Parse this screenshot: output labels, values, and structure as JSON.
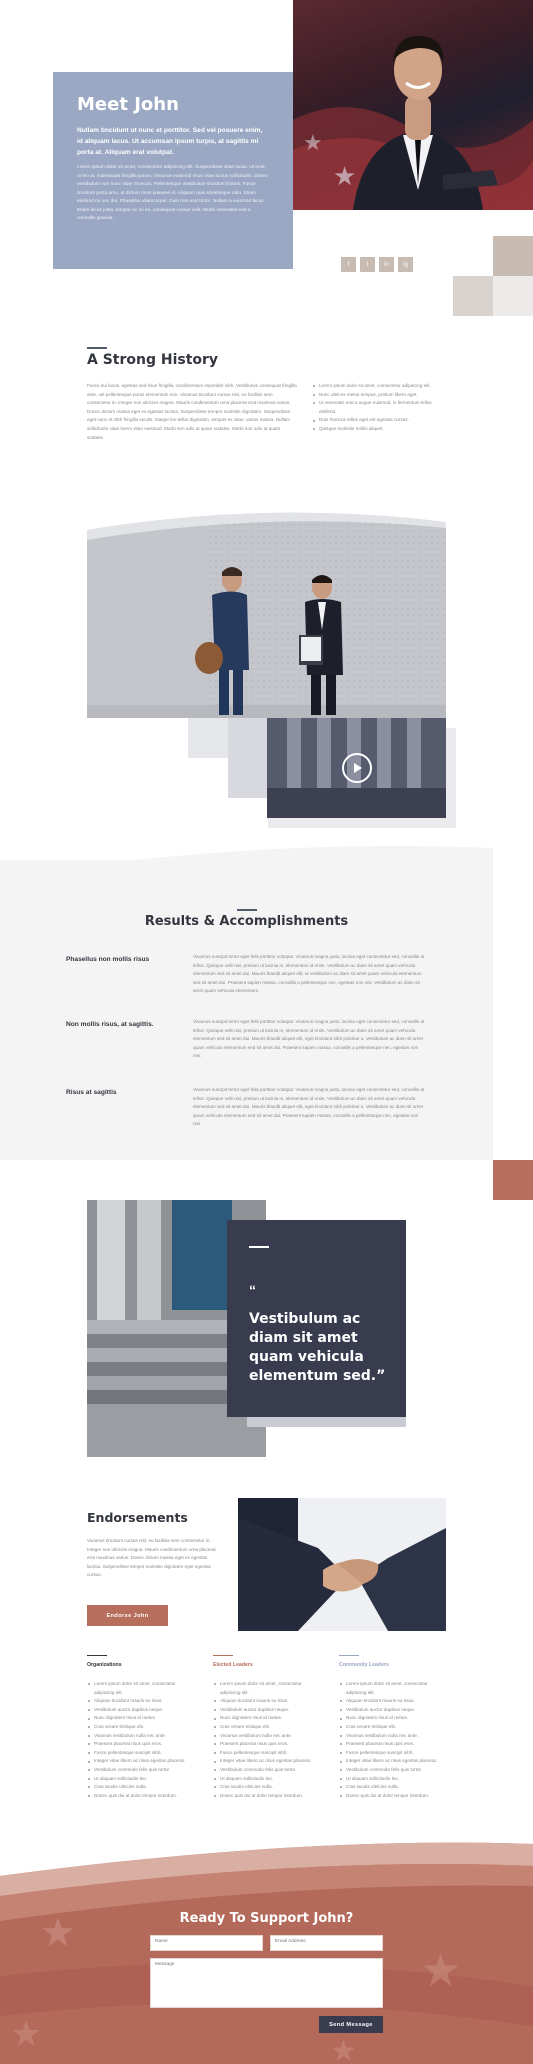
{
  "colors": {
    "accent_blue": "#9aa8c4",
    "navy": "#393b4f",
    "terracotta": "#b86e5c",
    "tan": "#c8bbb2",
    "light_gray": "#f4f4f5"
  },
  "hero": {
    "title": "Meet John",
    "lead": "Nullam tincidunt ut nunc et porttitor. Sed vel posuere enim, id aliquam lacus. Ut accumsan ipsum turpis, at sagittis mi porta at. Aliquam erat volutpat.",
    "body": "Lorem ipsum dolor sit amet, consectetur adipiscing elit. Suspendisse vitae lacus. Ut enim ut leo at, malesuada fringilla ipsum. Vivamus euismod risus vitae luctus sollicitudin. Donec vestibulum non nunc vitae rhoncus. Pellentesque vestibulum tincidunt finibus. Fusce tincidunt porta arcu, at dictum risus posuere id. Aliquam quis scelerisque odio. Etiam eleifend mi nec dui. Phasellus ullamcorper. Duis non erat tortor. Nullam a euismod lacus. Etiam lacus justo, tempor ac mi eu, consequat cursus velit. Morbi venenatis erat a convallis gravida.",
    "social": [
      "f",
      "t",
      "in",
      "ig"
    ],
    "social_icons": [
      "facebook-icon",
      "twitter-icon",
      "linkedin-icon",
      "instagram-icon"
    ]
  },
  "history": {
    "title": "A Strong History",
    "paragraph": "Fusce dui lacus, egestas sed risus fringilla, condimentum imperdiet nibh. Vestibulum consequat fringilla ante, vel pellentesque purus elementum non. Vivamus tincidunt cursus nisl, eu facilisis sem consectetur in. Integer non ultricies magna. Mauris condimentum urna placerat erat maximus varius. Donec dictum massa eget ex egestas lacinia. Suspendisse tempor molestie dignissim. Suspendisse eget nunc et nibh fringilla iaculis. Integer leo tellus dignissim, tempus ex vitae, varius massa. Nullam sollicitudin vitae lorem vitae euismod. Morbi non odio at quam sodales. Morbi non odio at quam sodales.",
    "bullets": [
      "Lorem ipsum dolor sit amet, consectetur adipiscing elit.",
      "Nunc ultrices metus tempus, pretium libero eget.",
      "Ut venenatis erat a augue euismod, in fermentum tellus eleifend.",
      "Duis rhoncus tellus eget est egestas cursus.",
      "Quisque molestie mollis aliquet."
    ]
  },
  "results": {
    "title": "Results & Accomplishments",
    "items": [
      {
        "heading": "Phasellus non mollis risus",
        "text": "Vivamus suscipit tortor eget felis porttitor volutpat. Vivamus magna justo, lacinia eget consectetur sed, convallis at tellus. Quisque velit nisi, pretium ut lacinia in, elementum id enim. Vestibulum ac diam sit amet quam vehicula elementum sed sit amet dui. Mauris blandit aliquet elit, ut vestibulum ac diam sit amet quam vehicula elementum sed sit amet dui. Praesent sapien massa, convallis a pellentesque nec, egestas non nisi. Vestibulum ac diam sit amet quam vehicula elementum."
      },
      {
        "heading": "Non mollis risus, at sagittis.",
        "text": "Vivamus suscipit tortor eget felis porttitor volutpat. Vivamus magna justo, lacinia eget consectetur sed, convallis at tellus. Quisque velit nisi, pretium ut lacinia in, elementum id enim. Vestibulum ac diam sit amet quam vehicula elementum sed sit amet dui. Mauris blandit aliquet elit, eget tincidunt nibh pulvinar a. Vestibulum ac diam sit amet quam vehicula elementum sed sit amet dui. Praesent sapien massa, convallis a pellentesque nec, egestas non nisi."
      },
      {
        "heading": "Risus at sagittis",
        "text": "Vivamus suscipit tortor eget felis porttitor volutpat. Vivamus magna justo, lacinia eget consectetur sed, convallis at tellus. Quisque velit nisi, pretium ut lacinia in, elementum id enim. Vestibulum ac diam sit amet quam vehicula elementum sed sit amet dui. Mauris blandit aliquet elit, eget tincidunt nibh pulvinar a. Vestibulum ac diam sit amet quam vehicula elementum sed sit amet dui. Praesent sapien massa, convallis a pellentesque nec, egestas non nisi."
      }
    ]
  },
  "quote": {
    "mark": "“",
    "text": "Vestibulum ac diam sit amet quam vehicula elementum sed.”"
  },
  "endorse": {
    "title": "Endorsements",
    "text": "Vivamus tincidunt cursus nisl, eu facilisis sem consectetur in. Integer non ultricies magna. Mauris condimentum urna placerat erat maximus varius. Donec dictum massa eget ex egestas lacinia. Suspendisse tempor molestie dignissim eget egestas cursus.",
    "button": "Endorse John",
    "columns": [
      {
        "title": "Organizations",
        "color": "#33363f",
        "items": [
          "Lorem ipsum dolor sit amet, consectetur adipiscing elit.",
          "Aliquam tincidunt mauris eu risus.",
          "Vestibulum auctor dapibus neque.",
          "Nunc dignissim risus id metus.",
          "Cras ornare tristique elit.",
          "Vivamus vestibulum nulla nec ante.",
          "Praesent placerat risus quis eros.",
          "Fusce pellentesque suscipit nibh.",
          "Integer vitae libero ac risus egestas placerat.",
          "Vestibulum commodo felis quis tortor.",
          "Ut aliquam sollicitudin leo.",
          "Cras iaculis ultricies nulla.",
          "Donec quis dui at dolor tempor interdum."
        ]
      },
      {
        "title": "Elected Leaders",
        "color": "#b86e5c",
        "items": [
          "Lorem ipsum dolor sit amet, consectetur adipiscing elit.",
          "Aliquam tincidunt mauris eu risus.",
          "Vestibulum auctor dapibus neque.",
          "Nunc dignissim risus id metus.",
          "Cras ornare tristique elit.",
          "Vivamus vestibulum nulla nec ante.",
          "Praesent placerat risus quis eros.",
          "Fusce pellentesque suscipit nibh.",
          "Integer vitae libero ac risus egestas placerat.",
          "Vestibulum commodo felis quis tortor.",
          "Ut aliquam sollicitudin leo.",
          "Cras iaculis ultricies nulla.",
          "Donec quis dui at dolor tempor interdum."
        ]
      },
      {
        "title": "Community Leaders",
        "color": "#9aa8c4",
        "items": [
          "Lorem ipsum dolor sit amet, consectetur adipiscing elit.",
          "Aliquam tincidunt mauris eu risus.",
          "Vestibulum auctor dapibus neque.",
          "Nunc dignissim risus id metus.",
          "Cras ornare tristique elit.",
          "Vivamus vestibulum nulla nec ante.",
          "Praesent placerat risus quis eros.",
          "Fusce pellentesque suscipit nibh.",
          "Integer vitae libero ac risus egestas placerat.",
          "Vestibulum commodo felis quis tortor.",
          "Ut aliquam sollicitudin leo.",
          "Cras iaculis ultricies nulla.",
          "Donec quis dui at dolor tempor interdum."
        ]
      }
    ]
  },
  "contact": {
    "title": "Ready To Support John?",
    "name_placeholder": "Name",
    "email_placeholder": "Email Address",
    "message_placeholder": "Message",
    "send": "Send Message"
  }
}
